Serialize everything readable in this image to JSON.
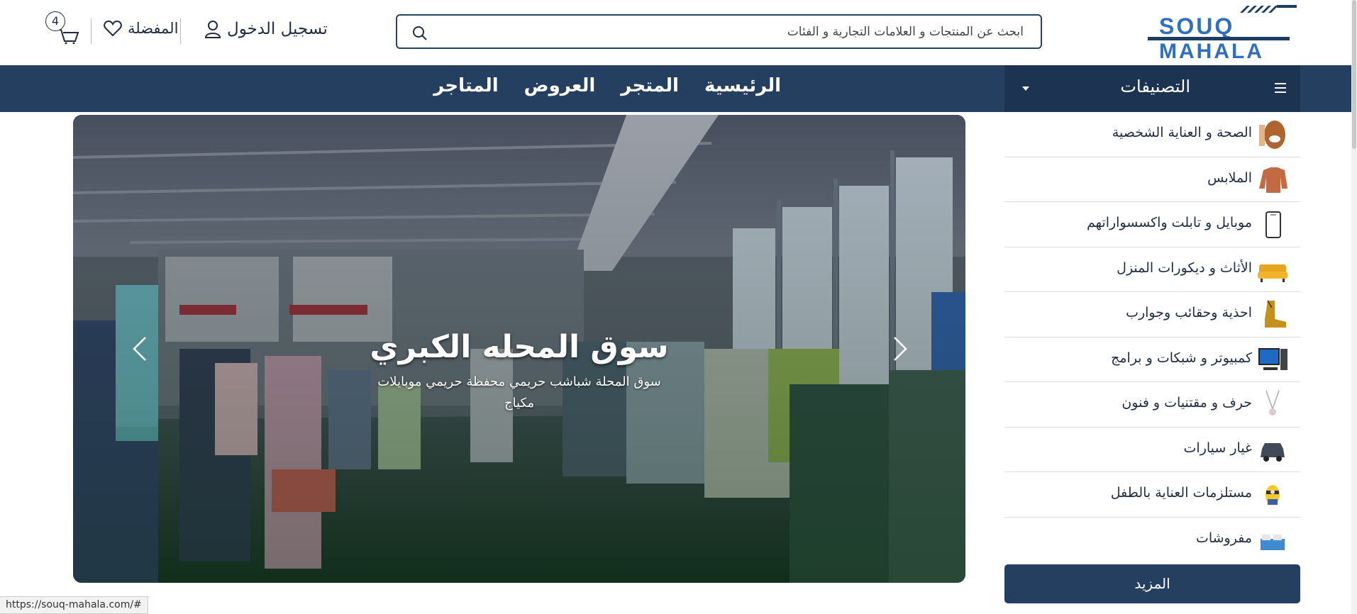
{
  "header": {
    "logo": {
      "line1": "SOUQ",
      "line2": "MAHALA",
      "alt": "souq-mahala-logo"
    },
    "search": {
      "placeholder": "ابحث عن المنتجات و العلامات التجارية و الفئات"
    },
    "login_label": "تسجيل الدخول",
    "favorites_label": "المفضلة",
    "cart_count": "4"
  },
  "navbar": {
    "categories_label": "التصنيفات",
    "links": [
      "الرئيسية",
      "المتجر",
      "العروض",
      "المتاجر"
    ]
  },
  "hero": {
    "title": "سوق المحله الكبري",
    "subtitle": "سوق المحلة شباشب حريمي محفظة حريمي موبايلات مكياج"
  },
  "categories": [
    {
      "label": "الصحة و العناية الشخصية",
      "icon": "face-care-icon"
    },
    {
      "label": "الملابس",
      "icon": "sweater-icon"
    },
    {
      "label": "موبايل و تابلت واكسسواراتهم",
      "icon": "phone-icon"
    },
    {
      "label": "الأثاث و ديكورات المنزل",
      "icon": "sofa-icon"
    },
    {
      "label": "احذية وحقائب وجوارب",
      "icon": "boot-icon"
    },
    {
      "label": "كمبيوتر و شبكات و برامج",
      "icon": "computer-icon"
    },
    {
      "label": "حرف و مقتنيات و فنون",
      "icon": "necklace-icon"
    },
    {
      "label": "غيار سيارات",
      "icon": "car-icon"
    },
    {
      "label": "مستلزمات العناية بالطفل",
      "icon": "baby-toy-icon"
    },
    {
      "label": "مفروشات",
      "icon": "bed-icon"
    }
  ],
  "more_label": "المزيد",
  "status_url": "https://souq-mahala.com/#",
  "colors": {
    "primary": "#253f61",
    "primary_dark": "#1c3352",
    "logo_blue": "#2f6fbf"
  }
}
